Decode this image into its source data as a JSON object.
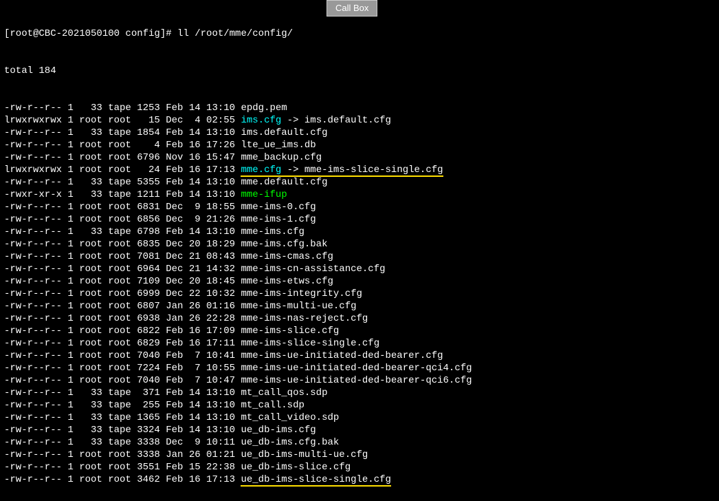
{
  "callbox_label": "Call Box",
  "prompt": "[root@CBC-2021050100 config]# ",
  "command": "ll /root/mme/config/",
  "total_line": "total 184",
  "rows": [
    {
      "perms": "-rw-r--r--",
      "links": "1",
      "owner": "  33",
      "group": "tape",
      "size": "1253",
      "date": "Feb 14 13:10",
      "name": "epdg.pem",
      "fclass": "fname"
    },
    {
      "perms": "lrwxrwxrwx",
      "links": "1",
      "owner": "root",
      "group": "root",
      "size": "  15",
      "date": "Dec  4 02:55",
      "name": "ims.cfg",
      "fclass": "symlink",
      "arrow": " -> ",
      "target": "ims.default.cfg"
    },
    {
      "perms": "-rw-r--r--",
      "links": "1",
      "owner": "  33",
      "group": "tape",
      "size": "1854",
      "date": "Feb 14 13:10",
      "name": "ims.default.cfg",
      "fclass": "fname"
    },
    {
      "perms": "-rw-r--r--",
      "links": "1",
      "owner": "root",
      "group": "root",
      "size": "   4",
      "date": "Feb 16 17:26",
      "name": "lte_ue_ims.db",
      "fclass": "fname"
    },
    {
      "perms": "-rw-r--r--",
      "links": "1",
      "owner": "root",
      "group": "root",
      "size": "6796",
      "date": "Nov 16 15:47",
      "name": "mme_backup.cfg",
      "fclass": "fname"
    },
    {
      "perms": "lrwxrwxrwx",
      "links": "1",
      "owner": "root",
      "group": "root",
      "size": "  24",
      "date": "Feb 16 17:13",
      "name": "mme.cfg",
      "fclass": "symlink",
      "arrow": " -> ",
      "target": "mme-ims-slice-single.cfg",
      "underline": true
    },
    {
      "perms": "-rw-r--r--",
      "links": "1",
      "owner": "  33",
      "group": "tape",
      "size": "5355",
      "date": "Feb 14 13:10",
      "name": "mme.default.cfg",
      "fclass": "fname"
    },
    {
      "perms": "-rwxr-xr-x",
      "links": "1",
      "owner": "  33",
      "group": "tape",
      "size": "1211",
      "date": "Feb 14 13:10",
      "name": "mme-ifup",
      "fclass": "exec"
    },
    {
      "perms": "-rw-r--r--",
      "links": "1",
      "owner": "root",
      "group": "root",
      "size": "6831",
      "date": "Dec  9 18:55",
      "name": "mme-ims-0.cfg",
      "fclass": "fname"
    },
    {
      "perms": "-rw-r--r--",
      "links": "1",
      "owner": "root",
      "group": "root",
      "size": "6856",
      "date": "Dec  9 21:26",
      "name": "mme-ims-1.cfg",
      "fclass": "fname"
    },
    {
      "perms": "-rw-r--r--",
      "links": "1",
      "owner": "  33",
      "group": "tape",
      "size": "6798",
      "date": "Feb 14 13:10",
      "name": "mme-ims.cfg",
      "fclass": "fname"
    },
    {
      "perms": "-rw-r--r--",
      "links": "1",
      "owner": "root",
      "group": "root",
      "size": "6835",
      "date": "Dec 20 18:29",
      "name": "mme-ims.cfg.bak",
      "fclass": "fname"
    },
    {
      "perms": "-rw-r--r--",
      "links": "1",
      "owner": "root",
      "group": "root",
      "size": "7081",
      "date": "Dec 21 08:43",
      "name": "mme-ims-cmas.cfg",
      "fclass": "fname"
    },
    {
      "perms": "-rw-r--r--",
      "links": "1",
      "owner": "root",
      "group": "root",
      "size": "6964",
      "date": "Dec 21 14:32",
      "name": "mme-ims-cn-assistance.cfg",
      "fclass": "fname"
    },
    {
      "perms": "-rw-r--r--",
      "links": "1",
      "owner": "root",
      "group": "root",
      "size": "7109",
      "date": "Dec 20 18:45",
      "name": "mme-ims-etws.cfg",
      "fclass": "fname"
    },
    {
      "perms": "-rw-r--r--",
      "links": "1",
      "owner": "root",
      "group": "root",
      "size": "6999",
      "date": "Dec 22 10:32",
      "name": "mme-ims-integrity.cfg",
      "fclass": "fname"
    },
    {
      "perms": "-rw-r--r--",
      "links": "1",
      "owner": "root",
      "group": "root",
      "size": "6807",
      "date": "Jan 26 01:16",
      "name": "mme-ims-multi-ue.cfg",
      "fclass": "fname"
    },
    {
      "perms": "-rw-r--r--",
      "links": "1",
      "owner": "root",
      "group": "root",
      "size": "6938",
      "date": "Jan 26 22:28",
      "name": "mme-ims-nas-reject.cfg",
      "fclass": "fname"
    },
    {
      "perms": "-rw-r--r--",
      "links": "1",
      "owner": "root",
      "group": "root",
      "size": "6822",
      "date": "Feb 16 17:09",
      "name": "mme-ims-slice.cfg",
      "fclass": "fname"
    },
    {
      "perms": "-rw-r--r--",
      "links": "1",
      "owner": "root",
      "group": "root",
      "size": "6829",
      "date": "Feb 16 17:11",
      "name": "mme-ims-slice-single.cfg",
      "fclass": "fname"
    },
    {
      "perms": "-rw-r--r--",
      "links": "1",
      "owner": "root",
      "group": "root",
      "size": "7040",
      "date": "Feb  7 10:41",
      "name": "mme-ims-ue-initiated-ded-bearer.cfg",
      "fclass": "fname"
    },
    {
      "perms": "-rw-r--r--",
      "links": "1",
      "owner": "root",
      "group": "root",
      "size": "7224",
      "date": "Feb  7 10:55",
      "name": "mme-ims-ue-initiated-ded-bearer-qci4.cfg",
      "fclass": "fname"
    },
    {
      "perms": "-rw-r--r--",
      "links": "1",
      "owner": "root",
      "group": "root",
      "size": "7040",
      "date": "Feb  7 10:47",
      "name": "mme-ims-ue-initiated-ded-bearer-qci6.cfg",
      "fclass": "fname"
    },
    {
      "perms": "-rw-r--r--",
      "links": "1",
      "owner": "  33",
      "group": "tape",
      "size": " 371",
      "date": "Feb 14 13:10",
      "name": "mt_call_qos.sdp",
      "fclass": "fname"
    },
    {
      "perms": "-rw-r--r--",
      "links": "1",
      "owner": "  33",
      "group": "tape",
      "size": " 255",
      "date": "Feb 14 13:10",
      "name": "mt_call.sdp",
      "fclass": "fname"
    },
    {
      "perms": "-rw-r--r--",
      "links": "1",
      "owner": "  33",
      "group": "tape",
      "size": "1365",
      "date": "Feb 14 13:10",
      "name": "mt_call_video.sdp",
      "fclass": "fname"
    },
    {
      "perms": "-rw-r--r--",
      "links": "1",
      "owner": "  33",
      "group": "tape",
      "size": "3324",
      "date": "Feb 14 13:10",
      "name": "ue_db-ims.cfg",
      "fclass": "fname"
    },
    {
      "perms": "-rw-r--r--",
      "links": "1",
      "owner": "  33",
      "group": "tape",
      "size": "3338",
      "date": "Dec  9 10:11",
      "name": "ue_db-ims.cfg.bak",
      "fclass": "fname"
    },
    {
      "perms": "-rw-r--r--",
      "links": "1",
      "owner": "root",
      "group": "root",
      "size": "3338",
      "date": "Jan 26 01:21",
      "name": "ue_db-ims-multi-ue.cfg",
      "fclass": "fname"
    },
    {
      "perms": "-rw-r--r--",
      "links": "1",
      "owner": "root",
      "group": "root",
      "size": "3551",
      "date": "Feb 15 22:38",
      "name": "ue_db-ims-slice.cfg",
      "fclass": "fname"
    },
    {
      "perms": "-rw-r--r--",
      "links": "1",
      "owner": "root",
      "group": "root",
      "size": "3462",
      "date": "Feb 16 17:13",
      "name": "ue_db-ims-slice-single.cfg",
      "fclass": "fname",
      "underline": true
    }
  ]
}
